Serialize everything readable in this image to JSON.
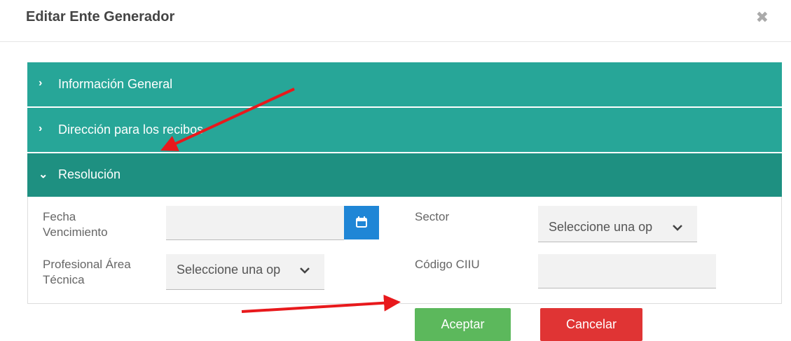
{
  "header": {
    "title": "Editar Ente Generador",
    "close_icon": "close-icon"
  },
  "panels": [
    {
      "label": "Información General",
      "chevron": "›",
      "expanded": false
    },
    {
      "label": "Dirección para los recibos",
      "chevron": "›",
      "expanded": false
    },
    {
      "label": "Resolución",
      "chevron": "⌄",
      "expanded": true
    }
  ],
  "form": {
    "fecha_vencimiento": {
      "label_line1": "Fecha",
      "label_line2": "Vencimiento",
      "value": ""
    },
    "profesional": {
      "label_line1": "Profesional Área",
      "label_line2": "Técnica",
      "selected": "Seleccione una op"
    },
    "sector": {
      "label": "Sector",
      "selected": "Seleccione una op"
    },
    "codigo_ciiu": {
      "label": "Código CIIU",
      "value": ""
    }
  },
  "buttons": {
    "accept": "Aceptar",
    "cancel": "Cancelar"
  },
  "colors": {
    "panel": "#27a698",
    "panel_active": "#1e9081",
    "accept": "#5cb85c",
    "cancel": "#e03434",
    "calendar_button": "#1f86d6",
    "annotation_arrow": "#e8191c"
  }
}
